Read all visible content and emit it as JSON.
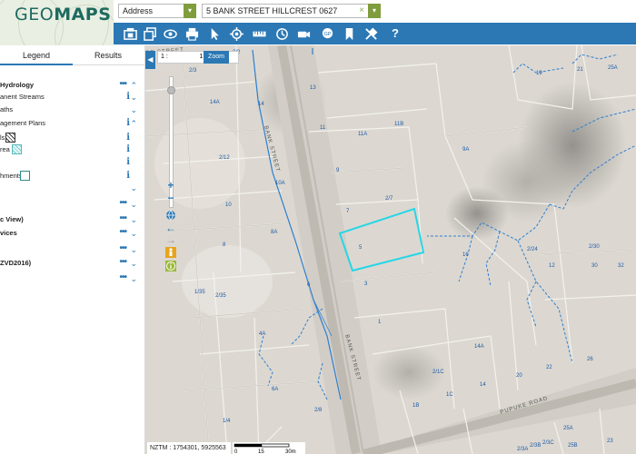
{
  "header": {
    "logo_text_light": "GEO",
    "logo_text_bold": "MAPS",
    "search_type": "Address",
    "address_value": "5 BANK STREET HILLCREST 0627",
    "clear_symbol": "×",
    "dropdown_symbol": "▾"
  },
  "toolbar": {
    "icons": [
      "home-icon",
      "layers-icon",
      "view-icon",
      "print-icon",
      "select-pointer-icon",
      "locate-target-icon",
      "measure-ruler-icon",
      "history-icon",
      "streetview-icon",
      "stamp-icon",
      "bookmark-icon",
      "tools-icon",
      "help-icon"
    ],
    "help_label": "?"
  },
  "panel": {
    "tabs": [
      "Legend",
      "Results"
    ],
    "rows": [
      {
        "label": "Hydrology",
        "bold": true
      },
      {
        "label": "anent Streams"
      },
      {
        "label": "aths"
      },
      {
        "label": "agement Plans"
      },
      {
        "label": "ls"
      },
      {
        "label": "rea"
      },
      {
        "label": "hments"
      },
      {
        "label": "c View)",
        "bold": true
      },
      {
        "label": "vices",
        "bold": true
      },
      {
        "label": "ZVD2016)",
        "bold": true
      }
    ],
    "info_symbol": "i",
    "dots_symbol": "•••",
    "chevron_down": "⌄",
    "chevron_up": "⌃",
    "colors": {
      "accent": "#2b78b5",
      "swatch_green": "#2b8a8a"
    }
  },
  "map": {
    "scale_prefix": "1 :",
    "scale_value": "1,000",
    "zoom_label": "Zoom",
    "collapse_symbol": "◀",
    "coords_text": "NZTM : 1754301, 5925563",
    "scalebar_labels": [
      "0",
      "15",
      "30m"
    ],
    "streets": [
      {
        "id": "bank-1",
        "text": "BANK STREET"
      },
      {
        "id": "bank-2",
        "text": "BANK STREET"
      },
      {
        "id": "pupuke",
        "text": "PUPUKE ROAD"
      },
      {
        "id": "top",
        "text": "RE STREET"
      }
    ],
    "lots": [
      "13",
      "14",
      "14A",
      "2/3",
      "2/2",
      "11",
      "11A",
      "11B",
      "9A",
      "9",
      "2/12",
      "10A",
      "10",
      "7",
      "2/7",
      "8A",
      "8",
      "5",
      "3",
      "16",
      "2/24",
      "2/30",
      "30",
      "32",
      "12",
      "6",
      "1/35",
      "2/35",
      "4A",
      "1",
      "14A",
      "2/1C",
      "14",
      "20",
      "22",
      "26",
      "1C",
      "1B",
      "6A",
      "2/8",
      "1/4",
      "25A",
      "19",
      "21",
      "25A",
      "2/3B",
      "2/3C",
      "25B",
      "23",
      "2/3A"
    ],
    "parcel_highlight": "#27d6e6"
  }
}
